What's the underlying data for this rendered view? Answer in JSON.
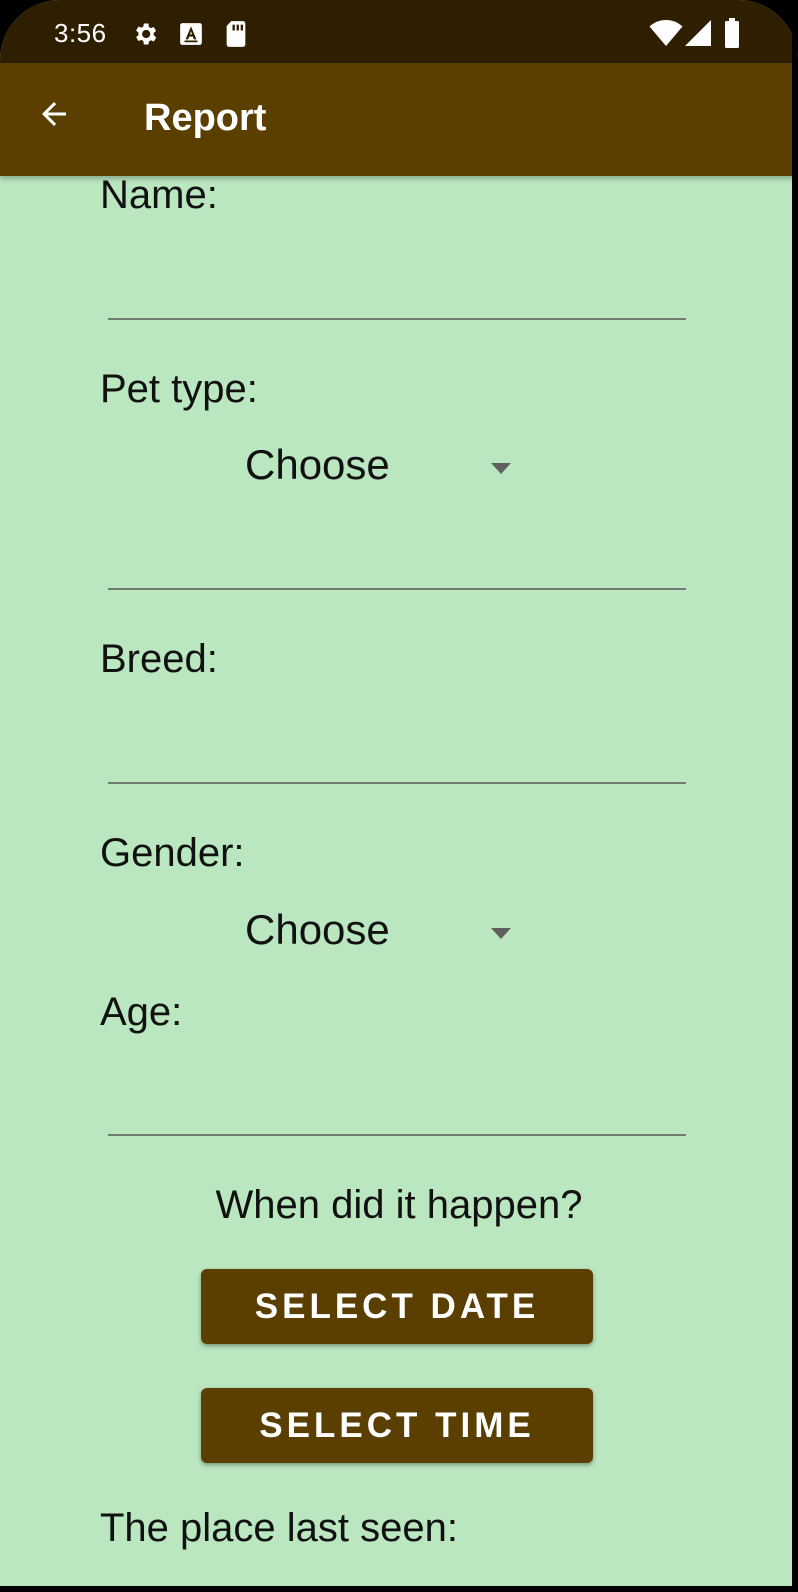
{
  "status_bar": {
    "time": "3:56",
    "icons": [
      "settings-icon",
      "a-keyboard-icon",
      "sd-card-icon",
      "wifi-icon",
      "signal-icon",
      "battery-icon"
    ]
  },
  "app_bar": {
    "title": "Report",
    "back_icon": "arrow-back-icon"
  },
  "form": {
    "name_label": "Name:",
    "name_value": "",
    "pet_type_label": "Pet type:",
    "pet_type_selected": "Choose",
    "breed_label": "Breed:",
    "breed_value": "",
    "gender_label": "Gender:",
    "gender_selected": "Choose",
    "age_label": "Age:",
    "age_value": "",
    "when_question": "When did it happen?",
    "select_date_label": "SELECT DATE",
    "select_time_label": "SELECT TIME",
    "place_label": "The place last seen:"
  },
  "colors": {
    "status_bar_bg": "#2e1f00",
    "app_bar_bg": "#5a3f00",
    "background": "#bae6c0",
    "button_bg": "#5a3f00",
    "button_text": "#ffffff"
  }
}
